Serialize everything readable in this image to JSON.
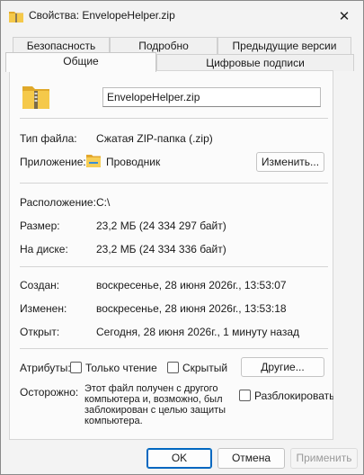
{
  "window": {
    "title": "Свойства: EnvelopeHelper.zip",
    "close_glyph": "✕"
  },
  "tabs": {
    "row_back": [
      "Безопасность",
      "Подробно",
      "Предыдущие версии"
    ],
    "row_front": [
      "Общие",
      "Цифровые подписи"
    ],
    "active": "Общие"
  },
  "general": {
    "file_name": "EnvelopeHelper.zip",
    "file_type_label": "Тип файла:",
    "file_type_value": "Сжатая ZIP-папка (.zip)",
    "app_label": "Приложение:",
    "app_value": "Проводник",
    "change_button": "Изменить...",
    "location_label": "Расположение:",
    "location_value": "C:\\",
    "size_label": "Размер:",
    "size_value": "23,2 МБ (24 334 297 байт)",
    "disk_label": "На диске:",
    "disk_value": "23,2 МБ (24 334 336 байт)",
    "created_label": "Создан:",
    "created_value": "воскресенье, 28 июня 2026г., 13:53:07",
    "modified_label": "Изменен:",
    "modified_value": "воскресенье, 28 июня 2026г., 13:53:18",
    "opened_label": "Открыт:",
    "opened_value": "Сегодня, 28 июня 2026г., 1 минуту назад",
    "attributes_label": "Атрибуты:",
    "readonly_label": "Только чтение",
    "hidden_label": "Скрытый",
    "other_button": "Другие...",
    "caution_label": "Осторожно:",
    "caution_lines": [
      "Этот файл получен с другого",
      "компьютера и, возможно, был",
      "заблокирован с целью защиты",
      "компьютера."
    ],
    "unblock_label": "Разблокировать"
  },
  "footer": {
    "ok": "OK",
    "cancel": "Отмена",
    "apply": "Применить"
  },
  "colors": {
    "accent": "#0067c0",
    "folder_yellow": "#f2c23d"
  },
  "icons": {
    "title": "zip-folder-icon",
    "file": "zip-folder-icon",
    "app": "explorer-folder-icon",
    "close": "close-icon"
  }
}
